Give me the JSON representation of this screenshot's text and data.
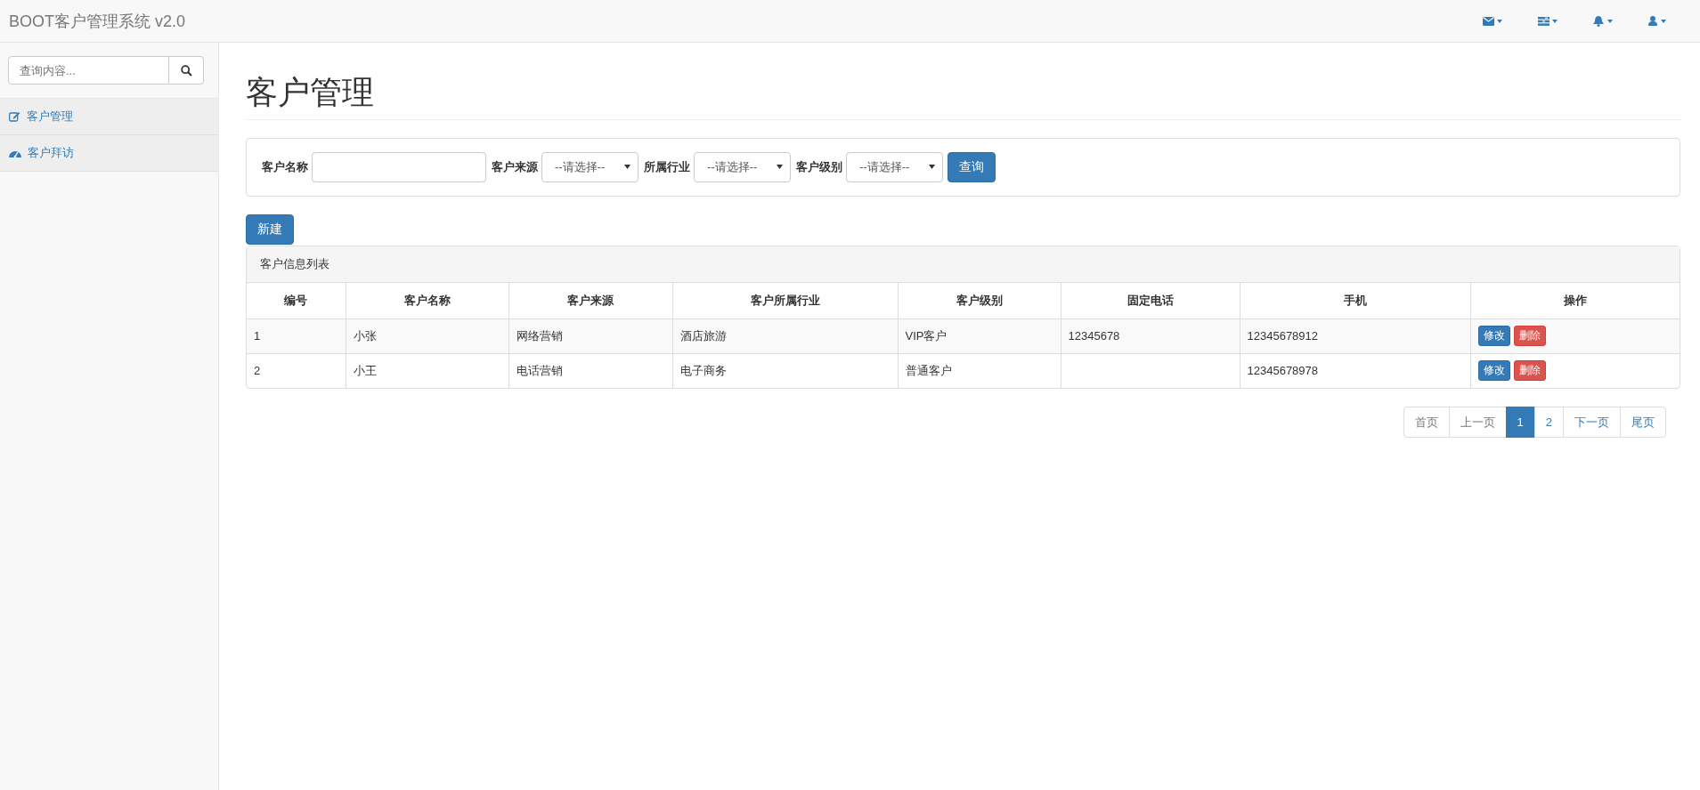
{
  "navbar": {
    "brand": "BOOT客户管理系统 v2.0"
  },
  "sidebar": {
    "search": {
      "placeholder": "查询内容..."
    },
    "items": [
      {
        "label": "客户管理"
      },
      {
        "label": "客户拜访"
      }
    ]
  },
  "page_title": "客户管理",
  "filters": [
    {
      "kind": "text",
      "label": "客户名称"
    },
    {
      "kind": "select",
      "label": "客户来源",
      "value": "--请选择--"
    },
    {
      "kind": "select",
      "label": "所属行业",
      "value": "--请选择--"
    },
    {
      "kind": "select",
      "label": "客户级别",
      "value": "--请选择--"
    }
  ],
  "query_button": "查询",
  "new_button": "新建",
  "table": {
    "title": "客户信息列表",
    "columns": [
      "编号",
      "客户名称",
      "客户来源",
      "客户所属行业",
      "客户级别",
      "固定电话",
      "手机",
      "操作"
    ],
    "rows": [
      {
        "cells": [
          "1",
          "小张",
          "网络营销",
          "酒店旅游",
          "VIP客户",
          "12345678",
          "12345678912"
        ],
        "actions": [
          "修改",
          "删除"
        ]
      },
      {
        "cells": [
          "2",
          "小王",
          "电话营销",
          "电子商务",
          "普通客户",
          "",
          "12345678978"
        ],
        "actions": [
          "修改",
          "删除"
        ]
      }
    ]
  },
  "pagination": [
    {
      "label": "首页",
      "selected": false,
      "disabled": true
    },
    {
      "label": "上一页",
      "selected": false,
      "disabled": true
    },
    {
      "label": "1",
      "selected": true,
      "disabled": false
    },
    {
      "label": "2",
      "selected": false,
      "disabled": false
    },
    {
      "label": "下一页",
      "selected": false,
      "disabled": false
    },
    {
      "label": "尾页",
      "selected": false,
      "disabled": false
    }
  ]
}
